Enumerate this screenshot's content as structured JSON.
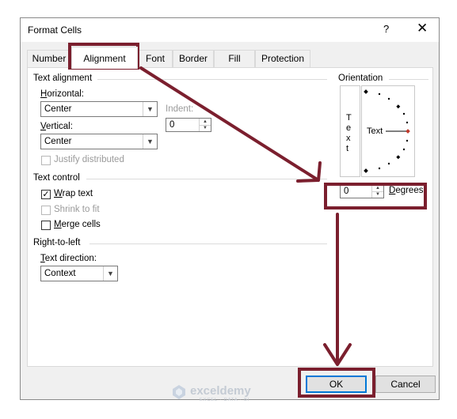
{
  "dialog": {
    "title": "Format Cells",
    "help_label": "?",
    "close_label": "✕"
  },
  "tabs": [
    {
      "label": "Number",
      "active": false
    },
    {
      "label": "Alignment",
      "active": true
    },
    {
      "label": "Font",
      "active": false
    },
    {
      "label": "Border",
      "active": false
    },
    {
      "label": "Fill",
      "active": false
    },
    {
      "label": "Protection",
      "active": false
    }
  ],
  "text_alignment": {
    "group_label": "Text alignment",
    "horizontal_label": "Horizontal:",
    "horizontal_value": "Center",
    "vertical_label": "Vertical:",
    "vertical_value": "Center",
    "indent_label": "Indent:",
    "indent_value": "0",
    "justify_distributed_label": "Justify distributed"
  },
  "text_control": {
    "group_label": "Text control",
    "wrap_text_label": "Wrap text",
    "wrap_text_checked": true,
    "shrink_to_fit_label": "Shrink to fit",
    "merge_cells_label": "Merge cells"
  },
  "rtl": {
    "group_label": "Right-to-left",
    "text_direction_label": "Text direction:",
    "text_direction_value": "Context"
  },
  "orientation": {
    "group_label": "Orientation",
    "vertical_text": "T\ne\nx\nt",
    "dial_text": "Text",
    "degrees_value": "0",
    "degrees_label": "Degrees"
  },
  "buttons": {
    "ok_label": "OK",
    "cancel_label": "Cancel"
  },
  "watermark": {
    "brand": "exceldemy",
    "tagline": "EXCEL · DATA · BI"
  },
  "colors": {
    "highlight": "#7b1f2e",
    "ok_border": "#0078d7"
  }
}
